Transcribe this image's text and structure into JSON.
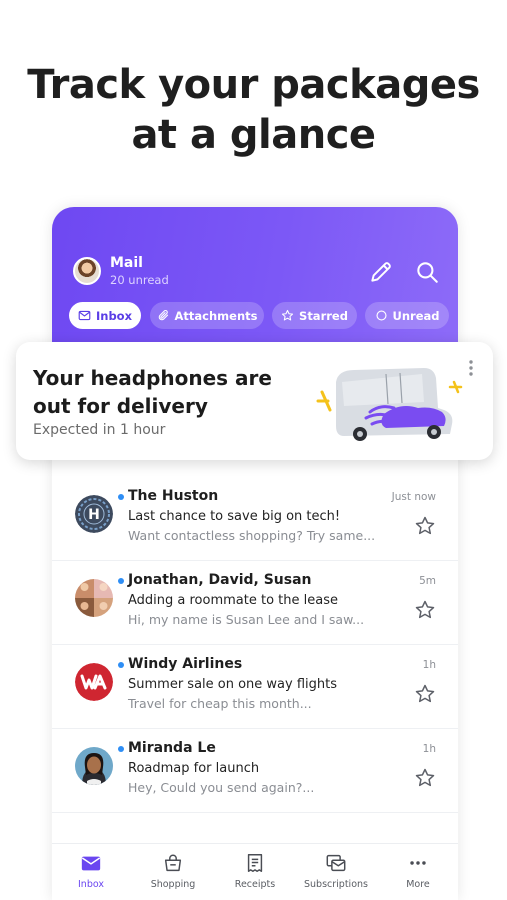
{
  "headline": {
    "line1": "Track your packages",
    "line2": "at a glance"
  },
  "header": {
    "title": "Mail",
    "unread_count": "20 unread",
    "filters": [
      "Inbox",
      "Attachments",
      "Starred",
      "Unread"
    ],
    "active_filter": "Inbox"
  },
  "delivery_card": {
    "title_line1": "Your headphones are",
    "title_line2": "out for delivery",
    "subtitle": "Expected in 1 hour",
    "icon": "delivery-truck-illustration"
  },
  "emails": [
    {
      "sender": "The Huston",
      "subject": "Last chance to save big on tech!",
      "preview": "Want contactless shopping? Try same...",
      "time": "Just now",
      "unread": true,
      "avatar": "h-logo"
    },
    {
      "sender": "Jonathan, David, Susan",
      "subject": "Adding a roommate to the lease",
      "preview": "Hi, my name is Susan Lee and I saw...",
      "time": "5m",
      "unread": true,
      "avatar": "group-photo"
    },
    {
      "sender": "Windy Airlines",
      "subject": "Summer sale on one way flights",
      "preview": "Travel for cheap this month...",
      "time": "1h",
      "unread": true,
      "avatar": "wa-logo"
    },
    {
      "sender": "Miranda Le",
      "subject": "Roadmap for launch",
      "preview": "Hey, Could you send again?...",
      "time": "1h",
      "unread": true,
      "avatar": "person-photo"
    }
  ],
  "nav": {
    "items": [
      "Inbox",
      "Shopping",
      "Receipts",
      "Subscriptions",
      "More"
    ],
    "active": "Inbox"
  },
  "colors": {
    "header_purple": "#7452f4",
    "accent": "#6a46f0",
    "unread_dot": "#2e8ef5",
    "windy_red": "#cf2631"
  }
}
